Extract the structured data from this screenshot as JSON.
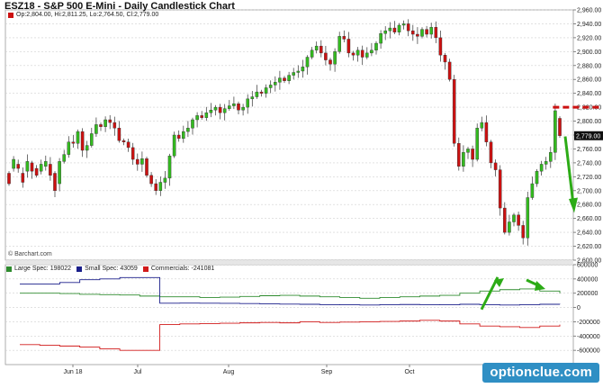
{
  "title": "ESZ18 - S&P 500 E-Mini - Daily Candlestick Chart",
  "ohlc_text": "Op:2,804.00, Hi:2,811.25, Lo:2,764.50, Cl:2,779.00",
  "credit": "© Barchart.com",
  "watermark": "optionclue.com",
  "colors": {
    "up": "#33bb1f",
    "down": "#cc1111",
    "large_spec": "#2e8b2e",
    "small_spec": "#1a1f8a",
    "commercials": "#d11a1a",
    "grid": "#d0d0d0",
    "price_marker_bg": "#111111",
    "annotation": "#2cab16"
  },
  "chart_data": [
    {
      "type": "candlestick",
      "title": "ESZ18 - S&P 500 E-Mini - Daily Candlestick Chart",
      "ylim": [
        2600,
        2960
      ],
      "yticks": [
        "2,960.00",
        "2,940.00",
        "2,920.00",
        "2,900.00",
        "2,880.00",
        "2,860.00",
        "2,840.00",
        "2,820.00",
        "2,800.00",
        "2,780.00",
        "2,760.00",
        "2,740.00",
        "2,720.00",
        "2,700.00",
        "2,680.00",
        "2,660.00",
        "2,640.00",
        "2,620.00",
        "2,600.00"
      ],
      "current_price_label": "2,779.00",
      "resistance_level": 2820,
      "closes": [
        2710,
        2745,
        2732,
        2712,
        2742,
        2728,
        2722,
        2738,
        2742,
        2722,
        2700,
        2742,
        2752,
        2770,
        2768,
        2785,
        2758,
        2765,
        2782,
        2795,
        2792,
        2802,
        2798,
        2790,
        2772,
        2770,
        2762,
        2745,
        2738,
        2746,
        2722,
        2710,
        2700,
        2712,
        2718,
        2750,
        2780,
        2775,
        2785,
        2790,
        2802,
        2808,
        2805,
        2812,
        2816,
        2820,
        2812,
        2818,
        2822,
        2825,
        2816,
        2820,
        2832,
        2835,
        2842,
        2840,
        2848,
        2852,
        2856,
        2862,
        2858,
        2866,
        2870,
        2872,
        2878,
        2892,
        2902,
        2908,
        2898,
        2888,
        2882,
        2900,
        2922,
        2918,
        2898,
        2895,
        2902,
        2892,
        2898,
        2902,
        2912,
        2926,
        2930,
        2934,
        2928,
        2938,
        2940,
        2930,
        2925,
        2922,
        2932,
        2925,
        2935,
        2920,
        2895,
        2885,
        2860,
        2768,
        2735,
        2755,
        2760,
        2745,
        2790,
        2798,
        2770,
        2740,
        2730,
        2675,
        2640,
        2655,
        2665,
        2650,
        2632,
        2690,
        2710,
        2728,
        2738,
        2742,
        2755,
        2815,
        2779
      ],
      "opens": [
        2725,
        2732,
        2738,
        2725,
        2728,
        2740,
        2732,
        2728,
        2735,
        2738,
        2725,
        2710,
        2742,
        2752,
        2770,
        2768,
        2785,
        2758,
        2765,
        2782,
        2795,
        2792,
        2802,
        2798,
        2790,
        2772,
        2770,
        2762,
        2745,
        2738,
        2746,
        2722,
        2710,
        2700,
        2712,
        2718,
        2750,
        2780,
        2775,
        2785,
        2790,
        2802,
        2808,
        2805,
        2812,
        2816,
        2820,
        2812,
        2818,
        2822,
        2825,
        2816,
        2820,
        2832,
        2835,
        2842,
        2840,
        2848,
        2852,
        2856,
        2862,
        2858,
        2866,
        2870,
        2872,
        2878,
        2892,
        2902,
        2908,
        2898,
        2888,
        2882,
        2900,
        2922,
        2918,
        2898,
        2895,
        2902,
        2892,
        2898,
        2902,
        2912,
        2926,
        2930,
        2934,
        2928,
        2938,
        2940,
        2930,
        2925,
        2922,
        2932,
        2925,
        2935,
        2920,
        2895,
        2885,
        2860,
        2768,
        2735,
        2755,
        2760,
        2745,
        2790,
        2798,
        2770,
        2740,
        2730,
        2675,
        2640,
        2655,
        2665,
        2650,
        2632,
        2690,
        2710,
        2728,
        2738,
        2742,
        2755,
        2804
      ]
    },
    {
      "type": "line",
      "panel": "COT",
      "ylim": [
        -800000,
        600000
      ],
      "yticks": [
        "600000",
        "400000",
        "200000",
        "0",
        "-200000",
        "-400000",
        "-600000"
      ],
      "xlabels": [
        "Jun 18",
        "Jul",
        "Aug",
        "Sep",
        "Oct"
      ],
      "series": [
        {
          "name": "Large Spec: 198022",
          "values": [
            200000,
            200000,
            195000,
            185000,
            180000,
            175000,
            160000,
            150000,
            150000,
            140000,
            145000,
            155000,
            165000,
            170000,
            160000,
            150000,
            140000,
            130000,
            140000,
            150000,
            160000,
            170000,
            200000,
            230000,
            250000,
            260000,
            230000,
            198022
          ]
        },
        {
          "name": "Small Spec: 43059",
          "values": [
            330000,
            330000,
            350000,
            390000,
            400000,
            420000,
            420000,
            60000,
            62000,
            60000,
            58000,
            55000,
            50000,
            48000,
            45000,
            40000,
            38000,
            35000,
            40000,
            42000,
            40000,
            38000,
            45000,
            40000,
            35000,
            40000,
            45000,
            43059
          ]
        },
        {
          "name": "Commercials: -241081",
          "values": [
            -520000,
            -530000,
            -540000,
            -555000,
            -580000,
            -600000,
            -600000,
            -240000,
            -230000,
            -225000,
            -220000,
            -215000,
            -210000,
            -215000,
            -200000,
            -210000,
            -205000,
            -200000,
            -195000,
            -190000,
            -180000,
            -190000,
            -230000,
            -260000,
            -270000,
            -280000,
            -260000,
            -241081
          ]
        }
      ]
    }
  ]
}
